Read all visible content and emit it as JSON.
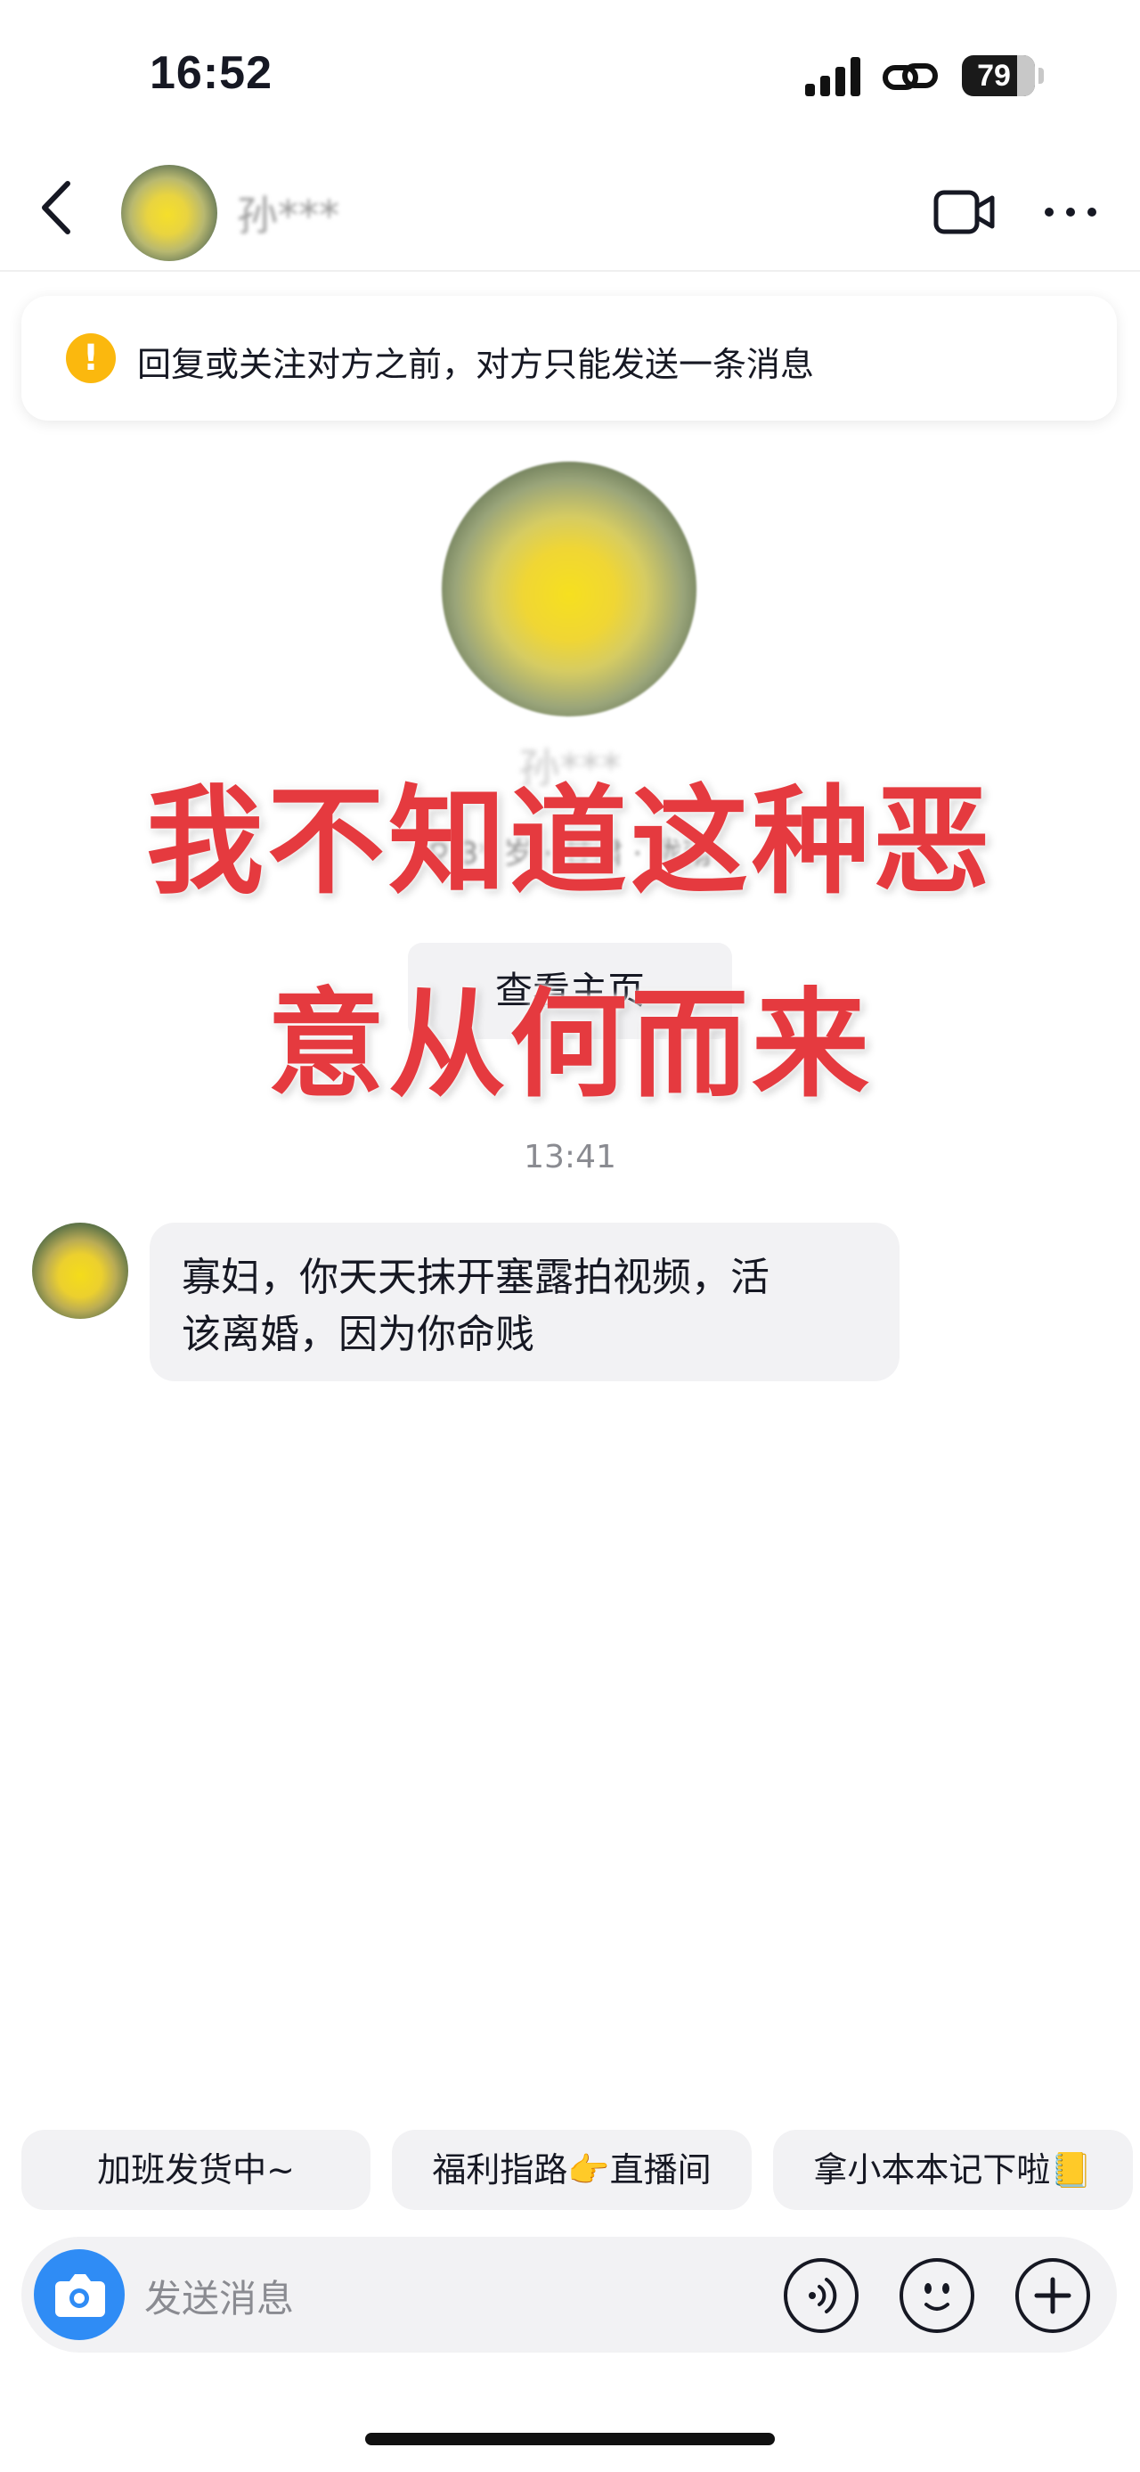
{
  "status_bar": {
    "time": "16:52",
    "battery": "79"
  },
  "header": {
    "name": "孙***",
    "icons": [
      "back-arrow-icon",
      "video-camera-icon",
      "more-dots-icon"
    ]
  },
  "notice": {
    "icon": "exclamation",
    "text": "回复或关注对方之前，对方只能发送一条消息"
  },
  "profile": {
    "name": "孙***",
    "meta": "♀ 3* 岁 · 甘肃 · 陇南",
    "view_button": "查看主页"
  },
  "overlay_caption": {
    "line1": "我不知道这种恶",
    "line2": "意从何而来",
    "color": "#e53a3f"
  },
  "conversation": {
    "time": "13:41",
    "messages": [
      {
        "line1": "寡妇，你天天抹开塞露拍视频，活",
        "line2": "该离婚，因为你命贱"
      }
    ]
  },
  "quick_replies": [
    "加班发货中~",
    "福利指路👉直播间",
    "拿小本本记下啦📒"
  ],
  "input": {
    "placeholder": "发送消息",
    "buttons": [
      "camera-icon",
      "voice-icon",
      "emoji-icon",
      "plus-icon"
    ]
  },
  "colors": {
    "accent_blue": "#2f8cf5",
    "warning_yellow": "#fbb80e",
    "bubble_gray": "#f2f2f4"
  }
}
